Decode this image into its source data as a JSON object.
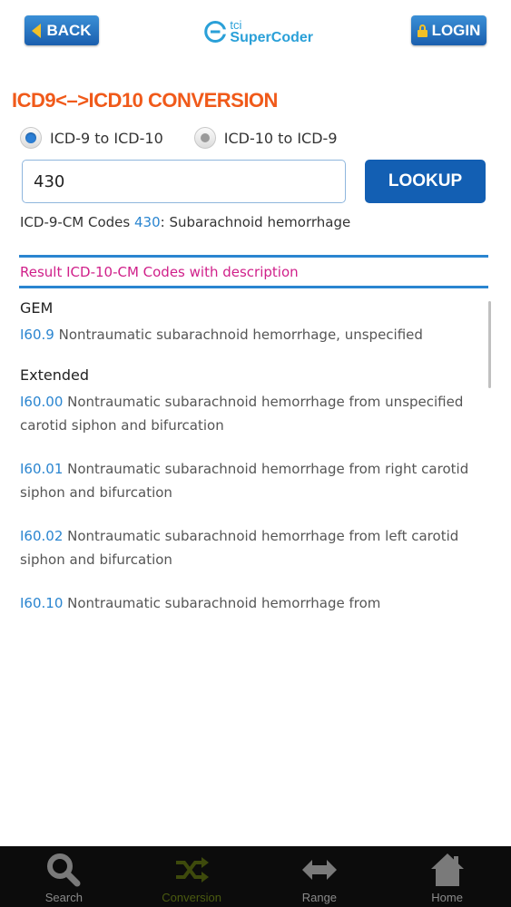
{
  "header": {
    "back_label": "BACK",
    "login_label": "LOGIN",
    "logo_small": "tci",
    "logo_name": "SuperCoder"
  },
  "page": {
    "title": "ICD9<–>ICD10 CONVERSION"
  },
  "conversion": {
    "options": [
      {
        "label": "ICD-9 to ICD-10",
        "selected": true
      },
      {
        "label": "ICD-10 to ICD-9",
        "selected": false
      }
    ],
    "input_value": "430",
    "lookup_label": "LOOKUP",
    "source_prefix": "ICD-9-CM Codes ",
    "source_code": "430",
    "source_desc": ": Subarachnoid hemorrhage"
  },
  "results": {
    "header": "Result ICD-10-CM Codes with description",
    "groups": [
      {
        "title": "GEM",
        "entries": [
          {
            "code": "I60.9",
            "desc": " Nontraumatic subarachnoid hemorrhage, unspecified"
          }
        ]
      },
      {
        "title": "Extended",
        "entries": [
          {
            "code": "I60.00",
            "desc": " Nontraumatic subarachnoid hemorrhage from unspecified carotid siphon and bifurcation"
          },
          {
            "code": "I60.01",
            "desc": " Nontraumatic subarachnoid hemorrhage from right carotid siphon and bifurcation"
          },
          {
            "code": "I60.02",
            "desc": " Nontraumatic subarachnoid hemorrhage from left carotid siphon and bifurcation"
          },
          {
            "code": "I60.10",
            "desc": " Nontraumatic subarachnoid hemorrhage from"
          }
        ]
      }
    ]
  },
  "tabs": [
    {
      "label": "Search",
      "icon": "search-icon",
      "active": false
    },
    {
      "label": "Conversion",
      "icon": "shuffle-icon",
      "active": true
    },
    {
      "label": "Range",
      "icon": "double-arrow-icon",
      "active": false
    },
    {
      "label": "Home",
      "icon": "home-icon",
      "active": false
    }
  ],
  "colors": {
    "accent_blue": "#135fb3",
    "title_orange": "#f05a1a",
    "result_header_magenta": "#d0208a",
    "code_blue": "#2a85d0",
    "active_tab": "#4a5a10"
  }
}
